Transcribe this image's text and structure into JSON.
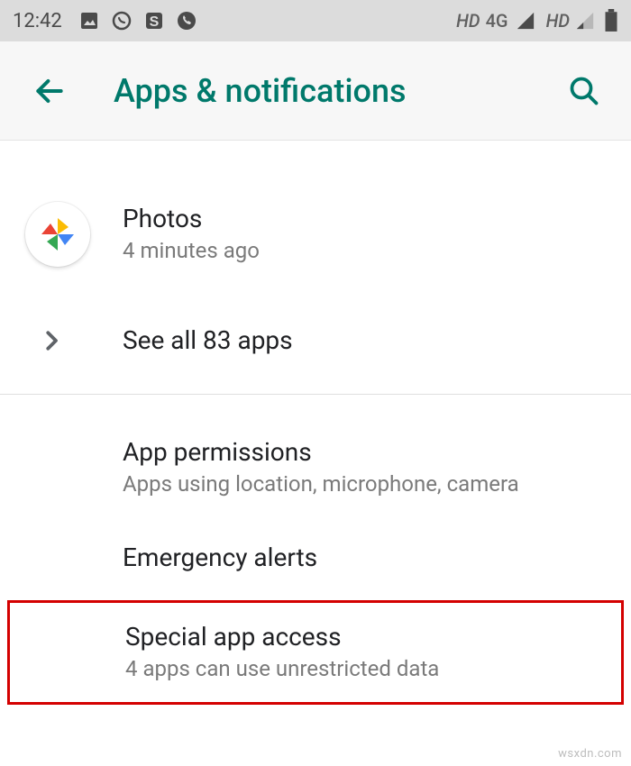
{
  "status_bar": {
    "clock": "12:42",
    "hd_label": "HD",
    "net_label": "4G"
  },
  "app_bar": {
    "title": "Apps & notifications"
  },
  "recent_app": {
    "name": "Photos",
    "subtitle": "4 minutes ago"
  },
  "see_all": {
    "label": "See all 83 apps"
  },
  "app_permissions": {
    "title": "App permissions",
    "subtitle": "Apps using location, microphone, camera"
  },
  "emergency_alerts": {
    "title": "Emergency alerts"
  },
  "special_access": {
    "title": "Special app access",
    "subtitle": "4 apps can use unrestricted data"
  },
  "watermark": "wsxdn.com"
}
